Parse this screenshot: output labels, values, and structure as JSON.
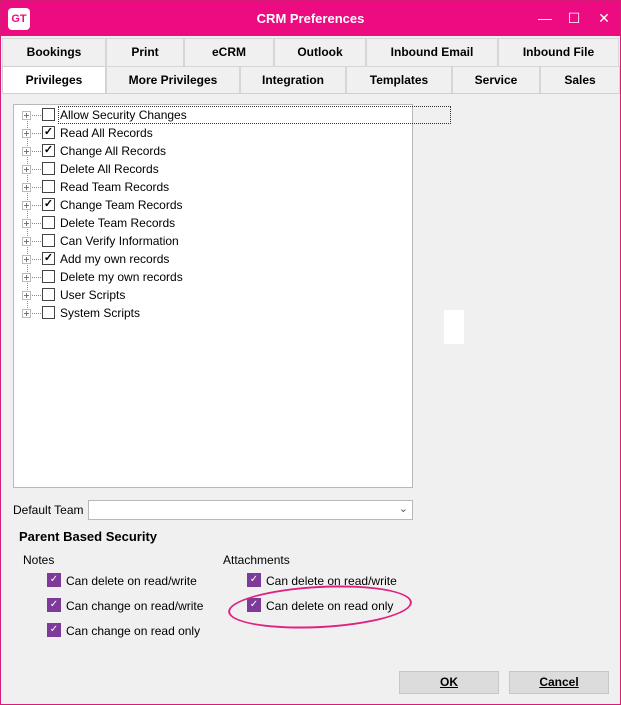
{
  "window": {
    "icon_text": "GT",
    "title": "CRM Preferences",
    "minimize": "—",
    "maximize": "☐",
    "close": "✕"
  },
  "tabs_row1": [
    "Bookings",
    "Print",
    "eCRM",
    "Outlook",
    "Inbound Email",
    "Inbound File"
  ],
  "tabs_row2": [
    "Privileges",
    "More Privileges",
    "Integration",
    "Templates",
    "Service",
    "Sales"
  ],
  "active_tab": "Privileges",
  "tree": {
    "items": [
      {
        "label": "Allow Security Changes",
        "checked": false
      },
      {
        "label": "Read All Records",
        "checked": true
      },
      {
        "label": "Change All Records",
        "checked": true
      },
      {
        "label": "Delete All Records",
        "checked": false
      },
      {
        "label": "Read Team Records",
        "checked": false
      },
      {
        "label": "Change Team Records",
        "checked": true
      },
      {
        "label": "Delete Team Records",
        "checked": false
      },
      {
        "label": "Can Verify Information",
        "checked": false
      },
      {
        "label": "Add my own records",
        "checked": true
      },
      {
        "label": "Delete my own records",
        "checked": false
      },
      {
        "label": "User Scripts",
        "checked": false
      },
      {
        "label": "System Scripts",
        "checked": false
      }
    ]
  },
  "default_team": {
    "label": "Default Team",
    "value": ""
  },
  "parent_security": {
    "title": "Parent Based Security",
    "notes": {
      "label": "Notes",
      "items": [
        {
          "label": "Can delete on read/write",
          "checked": true
        },
        {
          "label": "Can change on read/write",
          "checked": true
        },
        {
          "label": "Can change on read only",
          "checked": true
        }
      ]
    },
    "attachments": {
      "label": "Attachments",
      "items": [
        {
          "label": "Can delete on read/write",
          "checked": true
        },
        {
          "label": "Can delete on read only",
          "checked": true
        }
      ]
    }
  },
  "buttons": {
    "ok": "OK",
    "cancel": "Cancel"
  },
  "colors": {
    "accent": "#ec0b80",
    "checkbox": "#7d3a99"
  }
}
